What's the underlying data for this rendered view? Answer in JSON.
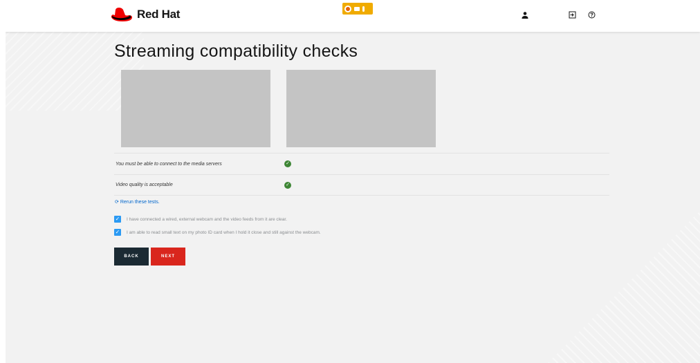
{
  "header": {
    "brand": "Red Hat",
    "icons": [
      "user-icon",
      "logout-icon",
      "help-icon"
    ]
  },
  "page": {
    "title": "Streaming compatibility checks"
  },
  "checks": [
    {
      "label": "You must be able to connect to the media servers",
      "status": "passed"
    },
    {
      "label": "Video quality is acceptable",
      "status": "passed"
    }
  ],
  "rerun_link": "Rerun these tests.",
  "acknowledgements": [
    {
      "text": "I have connected a wired, external webcam and the video feeds from it are clear.",
      "checked": true
    },
    {
      "text": "I am able to read small text on my photo ID card when I hold it close and still against the webcam.",
      "checked": true
    }
  ],
  "buttons": {
    "back": "BACK",
    "next": "NEXT"
  },
  "colors": {
    "brand_red": "#ee0000",
    "success": "#3e8635",
    "checkbox": "#2b9af3",
    "link": "#0066cc",
    "back_button": "#1b2a33",
    "next_button": "#d9261d"
  }
}
